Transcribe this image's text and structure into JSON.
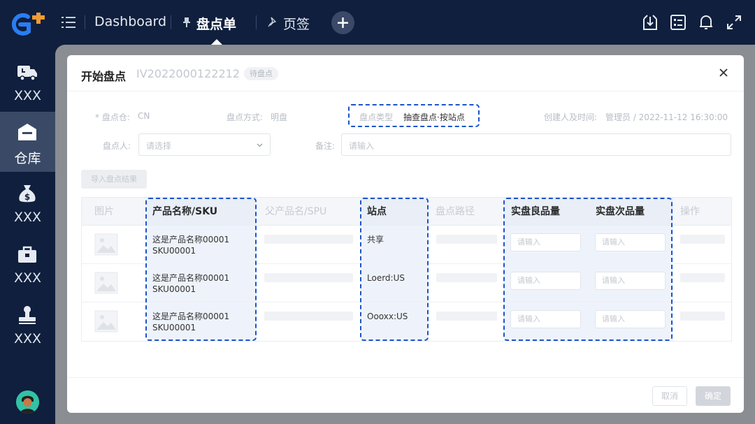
{
  "topbar": {
    "tabs": [
      {
        "label": "Dashboard"
      },
      {
        "label": "盘点单"
      },
      {
        "label": "页签"
      }
    ]
  },
  "sidebar": {
    "items": [
      {
        "label": "XXX",
        "icon": "delivery-truck-icon"
      },
      {
        "label": "仓库",
        "icon": "warehouse-icon"
      },
      {
        "label": "XXX",
        "icon": "money-bag-icon"
      },
      {
        "label": "XXX",
        "icon": "toolbox-icon"
      },
      {
        "label": "XXX",
        "icon": "stamp-icon"
      }
    ]
  },
  "modal": {
    "title": "开始盘点",
    "code": "IV2022000122212",
    "status": "待盘点",
    "form": {
      "warehouse_label": "* 盘点仓:",
      "warehouse_value": "CN",
      "method_label": "盘点方式:",
      "method_value": "明盘",
      "type_label": "盘点类型",
      "type_value": "抽查盘点·按站点",
      "creator_label": "创建人及时间:",
      "creator_value": "管理员 / 2022-11-12 16:30:00",
      "counter_label": "盘点人:",
      "counter_placeholder": "请选择",
      "note_label": "备注:",
      "note_placeholder": "请输入"
    },
    "import_button": "导入盘点结果",
    "table": {
      "headers": [
        "图片",
        "产品名称/SKU",
        "父产品名/SPU",
        "站点",
        "盘点路径",
        "实盘良品量",
        "实盘次品量",
        "操作"
      ],
      "rows": [
        {
          "name": "这是产品名称00001",
          "sku": "SKU00001",
          "site": "共享",
          "good": "请输入",
          "defect": "请输入"
        },
        {
          "name": "这是产品名称00001",
          "sku": "SKU00001",
          "site": "Loerd:US",
          "good": "请输入",
          "defect": "请输入"
        },
        {
          "name": "这是产品名称00001",
          "sku": "SKU00001",
          "site": "Oooxx:US",
          "good": "请输入",
          "defect": "请输入"
        }
      ]
    },
    "footer": {
      "cancel": "取消",
      "ok": "确定"
    }
  },
  "colors": {
    "nav_bg": "#0f1f3d",
    "accent_blue": "#1a55c7",
    "logo_orange": "#f29b33"
  }
}
